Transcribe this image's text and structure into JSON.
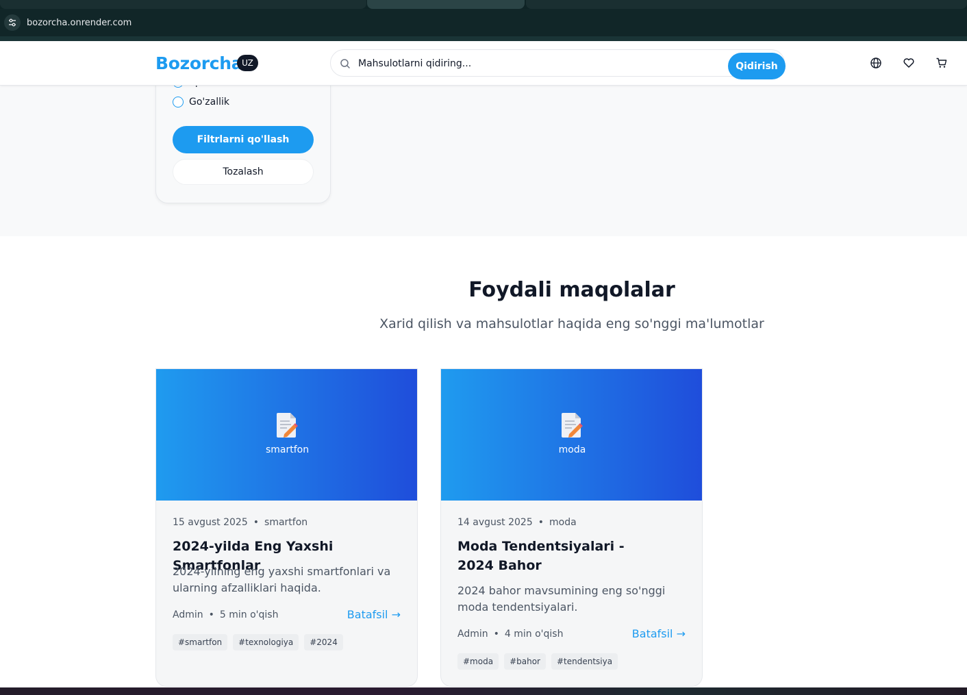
{
  "browser": {
    "url": "bozorcha.onrender.com"
  },
  "header": {
    "logo": "Bozorcha",
    "lang_badge": "UZ",
    "search_placeholder": "Mahsulotlarni qidiring...",
    "search_button": "Qidirish",
    "icons": [
      "globe-icon",
      "heart-icon",
      "cart-icon"
    ]
  },
  "filters": {
    "categories": [
      {
        "label": "Sport",
        "checked": false
      },
      {
        "label": "Go'zallik",
        "checked": false
      }
    ],
    "apply_label": "Filtrlarni qo'llash",
    "clear_label": "Tozalash"
  },
  "articles": {
    "title": "Foydali maqolalar",
    "subtitle": "Xarid qilish va mahsulotlar haqida eng so'nggi ma'lumotlar",
    "items": [
      {
        "hero_label": "smartfon",
        "date": "15 avgust 2025",
        "category": "smartfon",
        "title": "2024-yilda Eng Yaxshi Smartfonlar",
        "excerpt": "2024-yilning eng yaxshi smartfonlari va ularning afzalliklari haqida.",
        "author": "Admin",
        "read_time": "5 min o'qish",
        "more_label": "Batafsil →",
        "tags": [
          "#smartfon",
          "#texnologiya",
          "#2024"
        ]
      },
      {
        "hero_label": "moda",
        "date": "14 avgust 2025",
        "category": "moda",
        "title": "Moda Tendentsiyalari - 2024 Bahor",
        "excerpt": "2024 bahor mavsumining eng so'nggi moda tendentsiyalari.",
        "author": "Admin",
        "read_time": "4 min o'qish",
        "more_label": "Batafsil →",
        "tags": [
          "#moda",
          "#bahor",
          "#tendentsiya"
        ]
      }
    ]
  },
  "colors": {
    "accent": "#1d9bf0",
    "hero_gradient_start": "#1f9bef",
    "hero_gradient_end": "#1f4ddb"
  }
}
